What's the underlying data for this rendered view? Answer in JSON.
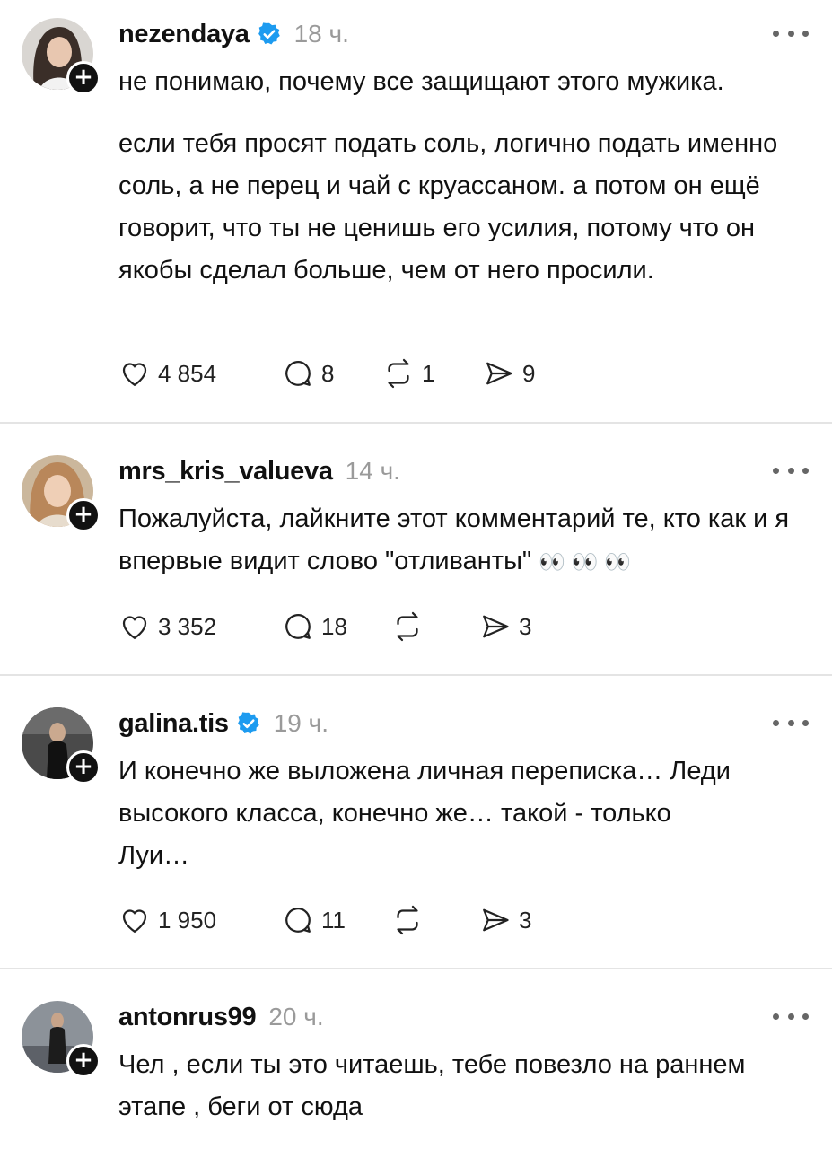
{
  "posts": [
    {
      "username": "nezendaya",
      "verified": true,
      "time": "18 ч.",
      "paragraphs": [
        "не понимаю, почему все защищают этого мужика.",
        "если тебя просят подать соль, логично подать именно соль, а не перец и чай с круассаном. а потом он ещё говорит, что ты не ценишь его усилия, потому что он якобы сделал больше, чем от него просили."
      ],
      "likes": "4 854",
      "comments": "8",
      "reposts": "1",
      "shares": "9"
    },
    {
      "username": "mrs_kris_valueva",
      "verified": false,
      "time": "14 ч.",
      "paragraphs": [
        "Пожалуйста, лайкните этот комментарий те, кто как и я впервые видит слово \"отливанты\""
      ],
      "emoji": "👀 👀 👀",
      "likes": "3 352",
      "comments": "18",
      "reposts": "",
      "shares": "3"
    },
    {
      "username": "galina.tis",
      "verified": true,
      "time": "19 ч.",
      "paragraphs": [
        "И конечно же выложена личная переписка… Леди высокого класса, конечно же… такой - только Луи…"
      ],
      "likes": "1 950",
      "comments": "11",
      "reposts": "",
      "shares": "3"
    },
    {
      "username": "antonrus99",
      "verified": false,
      "time": "20 ч.",
      "paragraphs": [
        "Чел , если ты это читаешь, тебе повезло на раннем этапе , беги от сюда"
      ]
    }
  ],
  "colors": {
    "verified": "#1d9bf0",
    "muted": "#9a9a9a",
    "divider": "#e4e4e4"
  },
  "icons": [
    "heart-icon",
    "comment-icon",
    "repost-icon",
    "share-icon",
    "more-icon",
    "verified-badge-icon",
    "follow-plus-icon"
  ]
}
